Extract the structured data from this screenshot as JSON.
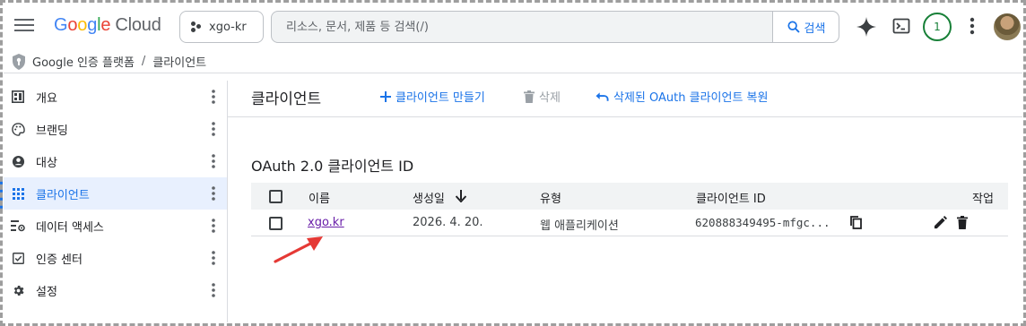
{
  "app": {
    "logo_google": [
      "G",
      "o",
      "o",
      "g",
      "l",
      "e"
    ],
    "logo_product": "Cloud",
    "project_name": "xgo-kr",
    "search_placeholder": "리소스, 문서, 제품 등 검색(/)",
    "search_button": "검색",
    "notification_count": "1"
  },
  "breadcrumb": {
    "items": [
      "Google 인증 플랫폼",
      "클라이언트"
    ],
    "separator": "/"
  },
  "sidebar": {
    "items": [
      {
        "label": "개요",
        "icon": "dashboard-icon",
        "active": false
      },
      {
        "label": "브랜딩",
        "icon": "palette-icon",
        "active": false
      },
      {
        "label": "대상",
        "icon": "account-circle-icon",
        "active": false
      },
      {
        "label": "클라이언트",
        "icon": "apps-grid-icon",
        "active": true
      },
      {
        "label": "데이터 액세스",
        "icon": "data-settings-icon",
        "active": false
      },
      {
        "label": "인증 센터",
        "icon": "verified-checkbox-icon",
        "active": false
      },
      {
        "label": "설정",
        "icon": "gear-icon",
        "active": false
      }
    ]
  },
  "main": {
    "title": "클라이언트",
    "actions": {
      "create": "클라이언트 만들기",
      "delete": "삭제",
      "restore": "삭제된 OAuth 클라이언트 복원"
    },
    "section_title": "OAuth 2.0 클라이언트 ID",
    "table": {
      "columns": [
        "이름",
        "생성일",
        "유형",
        "클라이언트 ID",
        "작업"
      ],
      "sort_column": "생성일",
      "sort_direction": "descending",
      "rows": [
        {
          "name": "xgo.kr",
          "created": "2026. 4. 20.",
          "type": "웹 애플리케이션",
          "client_id": "620888349495-mfgc..."
        }
      ]
    }
  },
  "colors": {
    "accent": "#1a73e8",
    "link_visited": "#681da8",
    "annotation_arrow": "#e53935",
    "active_bg": "#e8f0fe"
  }
}
